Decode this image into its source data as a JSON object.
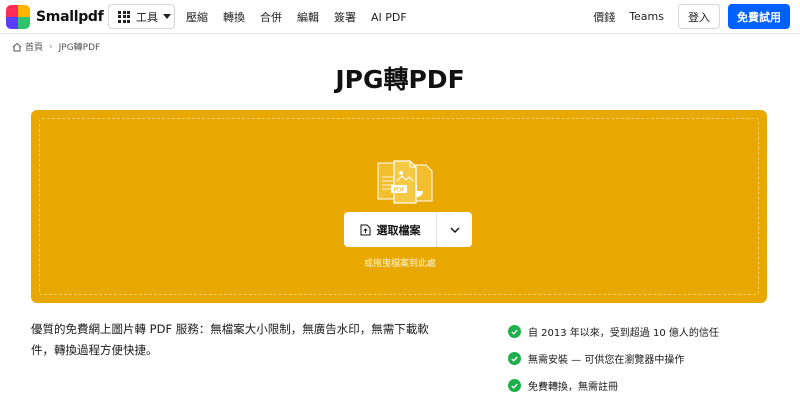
{
  "brand": {
    "name": "Smallpdf",
    "logo_colors": [
      "#ff2d55",
      "#ffb400",
      "#5a3cff",
      "#2cc46a"
    ]
  },
  "header": {
    "tools_label": "工具",
    "nav": [
      "壓縮",
      "轉換",
      "合併",
      "編輯",
      "簽署",
      "AI PDF"
    ],
    "pricing_label": "價錢",
    "teams_label": "Teams",
    "login_label": "登入",
    "trial_label": "免費試用"
  },
  "breadcrumb": {
    "home": "首頁",
    "current": "JPG轉PDF"
  },
  "page": {
    "title": "JPG轉PDF"
  },
  "dropzone": {
    "color": "#e8a800",
    "file_badge": "PDF",
    "choose_label": "選取檔案",
    "hint": "或拖曳檔案到此處"
  },
  "description": "優質的免費網上圖片轉 PDF 服務：無檔案大小限制，無廣告水印，無需下載軟件，轉換過程方便快捷。",
  "features": [
    "自 2013 年以來，受到超過 10 億人的信任",
    "無需安裝 — 可供您在瀏覽器中操作",
    "免費轉換，無需註冊"
  ]
}
